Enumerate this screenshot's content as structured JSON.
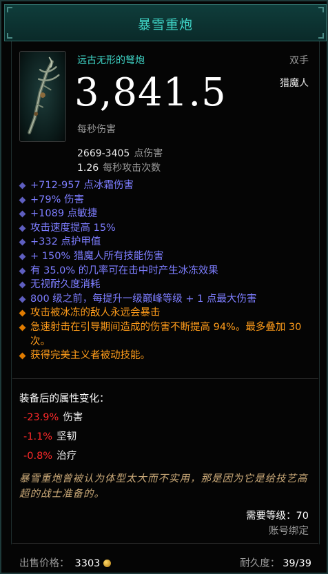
{
  "item": {
    "name": "暴雪重炮",
    "type": "远古无形的弩炮",
    "slot": "双手",
    "class": "猎魔人",
    "dps": "3,841.5",
    "dps_label": "每秒伤害",
    "damage_range": "2669-3405",
    "damage_label": "点伤害",
    "attack_speed": "1.26",
    "attack_speed_label": "每秒攻击次数",
    "icon": "crossbow-icon"
  },
  "affixes": [
    {
      "text": "+712-957 点冰霜伤害",
      "color": "blue"
    },
    {
      "text": "+79% 伤害",
      "color": "blue"
    },
    {
      "text": "+1089 点敏捷",
      "color": "blue"
    },
    {
      "text": "攻击速度提高 15%",
      "color": "blue"
    },
    {
      "text": "+332 点护甲值",
      "color": "blue"
    },
    {
      "text": "+ 150% 猎魔人所有技能伤害",
      "color": "blue"
    },
    {
      "text": "有 35.0% 的几率可在击中时产生冰冻效果",
      "color": "blue"
    },
    {
      "text": "无视耐久度消耗",
      "color": "blue"
    },
    {
      "text": "800 级之前，每提升一级巅峰等级 + 1 点最大伤害",
      "color": "blue"
    },
    {
      "text": "攻击被冰冻的敌人永远会暴击",
      "color": "orange"
    },
    {
      "text": "急速射击在引导期间造成的伤害不断提高 94%。最多叠加 30 次。",
      "color": "orange"
    },
    {
      "text": "获得完美主义者被动技能。",
      "color": "orange"
    }
  ],
  "stat_changes": {
    "title": "装备后的属性变化：",
    "items": [
      {
        "value": "-23.9%",
        "name": "伤害"
      },
      {
        "value": "-1.1%",
        "name": "坚韧"
      },
      {
        "value": "-0.8%",
        "name": "治疗"
      }
    ]
  },
  "flavor_text": "暴雪重炮曾被认为体型太大而不实用，那是因为它是给技艺高超的战士准备的。",
  "required_level": "需要等级：70",
  "account_bound": "账号绑定",
  "footer": {
    "sell_label": "出售价格：",
    "sell_value": "3303",
    "currency_icon": "gold-coin-icon",
    "durability_label": "耐久度：",
    "durability_value": "39/39"
  },
  "colors": {
    "title": "#3fd6c8",
    "magic_affix": "#7d7dff",
    "legendary_affix": "#ff9c1a",
    "negative": "#ff2a2a",
    "flavor": "#c9a877"
  }
}
